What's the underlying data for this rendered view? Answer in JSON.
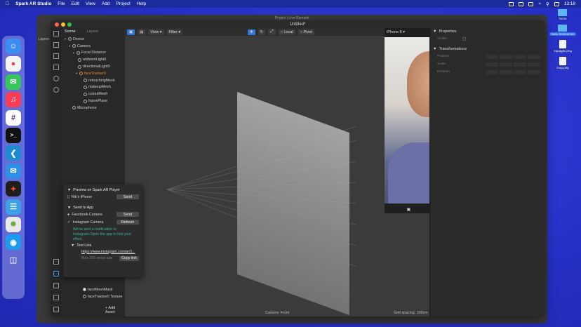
{
  "menubar": {
    "app": "Spark AR Studio",
    "items": [
      "File",
      "Edit",
      "View",
      "Add",
      "Project",
      "Help"
    ],
    "time": "13:18"
  },
  "background_window": {
    "title": "Project | Live Ramaxk",
    "side_label": "Layers"
  },
  "desktop_icons": [
    {
      "label": "home",
      "kind": "folder"
    },
    {
      "label": "base-ressources",
      "kind": "folder",
      "selected": true
    },
    {
      "label": "equipgtx.png",
      "kind": "file"
    },
    {
      "label": "loop.png",
      "kind": "file"
    }
  ],
  "window": {
    "title": "Untitled*"
  },
  "scene_panel": {
    "tabs": [
      "Scene",
      "Layers"
    ],
    "tree": [
      {
        "label": "Device",
        "depth": 0,
        "icon": "device-icon"
      },
      {
        "label": "Camera",
        "depth": 1,
        "icon": "camera-icon"
      },
      {
        "label": "Focal Distance",
        "depth": 2,
        "icon": "focal-icon"
      },
      {
        "label": "ambientLight0",
        "depth": 3,
        "icon": "light-icon"
      },
      {
        "label": "directionalLight0",
        "depth": 3,
        "icon": "light-icon"
      },
      {
        "label": "faceTracker0",
        "depth": 3,
        "icon": "face-tracker-icon",
        "highlight": true
      },
      {
        "label": "retouchingMesh",
        "depth": 4,
        "icon": "mesh-icon"
      },
      {
        "label": "makeupMesh",
        "depth": 4,
        "icon": "mesh-icon"
      },
      {
        "label": "cutoutMesh",
        "depth": 4,
        "icon": "mesh-icon"
      },
      {
        "label": "framePlane",
        "depth": 4,
        "icon": "plane-icon"
      },
      {
        "label": "Microphone",
        "depth": 1,
        "icon": "microphone-icon"
      }
    ],
    "assets": [
      "faceMeshMask",
      "faceTracker0 Texture"
    ],
    "add_asset": "+ Add Asset"
  },
  "viewport": {
    "toolbar": {
      "view": "View",
      "filter": "Filter",
      "local": "Local",
      "pivot": "Pivot"
    },
    "footer_camera": "Camera: Front",
    "footer_grid": "Grid spacing: 100cm"
  },
  "phone_preview": {
    "device": "iPhone 8"
  },
  "properties": {
    "title": "Properties",
    "visible_label": "Visible",
    "transformations_title": "Transformations",
    "rows": [
      "Position",
      "Scale",
      "Rotation"
    ]
  },
  "preview_popup": {
    "title": "Preview on Spark AR Player",
    "device_name": "Rik's iPhone",
    "device_button": "Send",
    "send_title": "Send to App",
    "apps": [
      {
        "label": "Facebook Camera",
        "button": "Send",
        "checked": false
      },
      {
        "label": "Instagram Camera",
        "button": "Refresh",
        "checked": true
      }
    ],
    "notice": "We've sent a notification to Instagram.Open the app to test your effect.",
    "test_link_title": "Test Link",
    "link": "https://www.instagram.com/ar/1...",
    "max_views": "Max 200 views tota",
    "copy_button": "Copy link"
  }
}
